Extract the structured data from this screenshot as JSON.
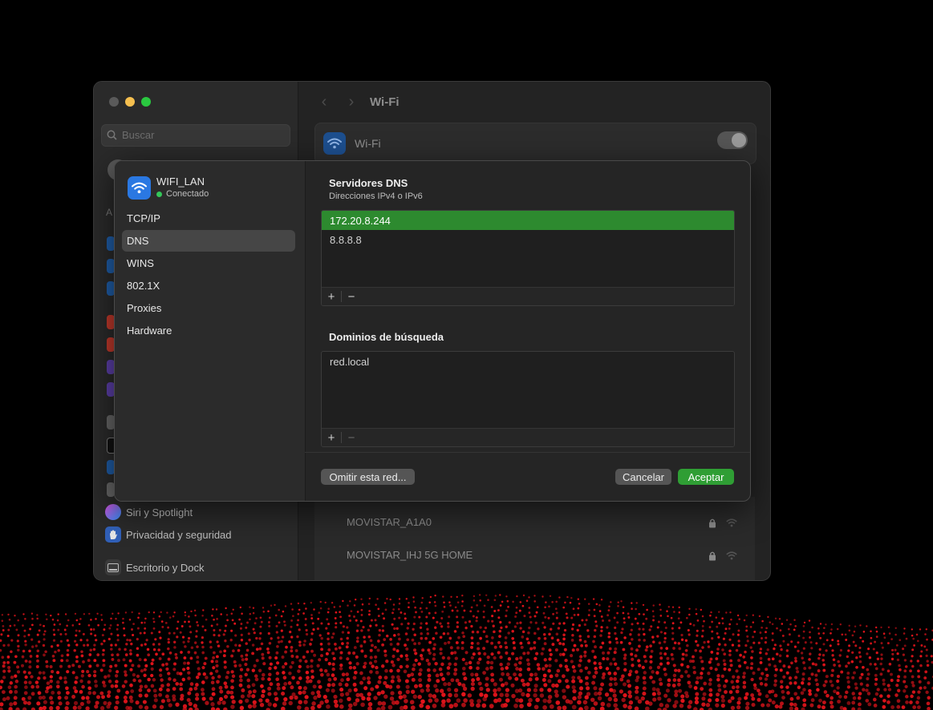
{
  "window": {
    "title": "Wi-Fi",
    "search_placeholder": "Buscar",
    "sidebar_partial_label": "A",
    "sidebar_items": [
      {
        "label": "Siri y Spotlight",
        "icon": "siri-icon"
      },
      {
        "label": "Privacidad y seguridad",
        "icon": "hand-icon"
      },
      {
        "label": "Escritorio y Dock",
        "icon": "dock-icon"
      }
    ],
    "wifi_row_label": "Wi-Fi",
    "networks": [
      {
        "name": "MOVISTAR_A1A0"
      },
      {
        "name": "MOVISTAR_IHJ 5G HOME"
      }
    ]
  },
  "dialog": {
    "network_name": "WIFI_LAN",
    "network_status": "Conectado",
    "menu": [
      "TCP/IP",
      "DNS",
      "WINS",
      "802.1X",
      "Proxies",
      "Hardware"
    ],
    "selected_menu": "DNS",
    "dns": {
      "title": "Servidores DNS",
      "subtitle": "Direcciones IPv4 o IPv6",
      "servers": [
        "172.20.8.244",
        "8.8.8.8"
      ]
    },
    "search_domains": {
      "title": "Dominios de búsqueda",
      "domains": [
        "red.local"
      ]
    },
    "add_label": "+",
    "remove_label": "−",
    "buttons": {
      "forget": "Omitir esta red...",
      "cancel": "Cancelar",
      "ok": "Aceptar"
    }
  },
  "colors": {
    "accent_green": "#2d8a2f",
    "status_green": "#34c759",
    "wifi_blue": "#2a78e2"
  }
}
